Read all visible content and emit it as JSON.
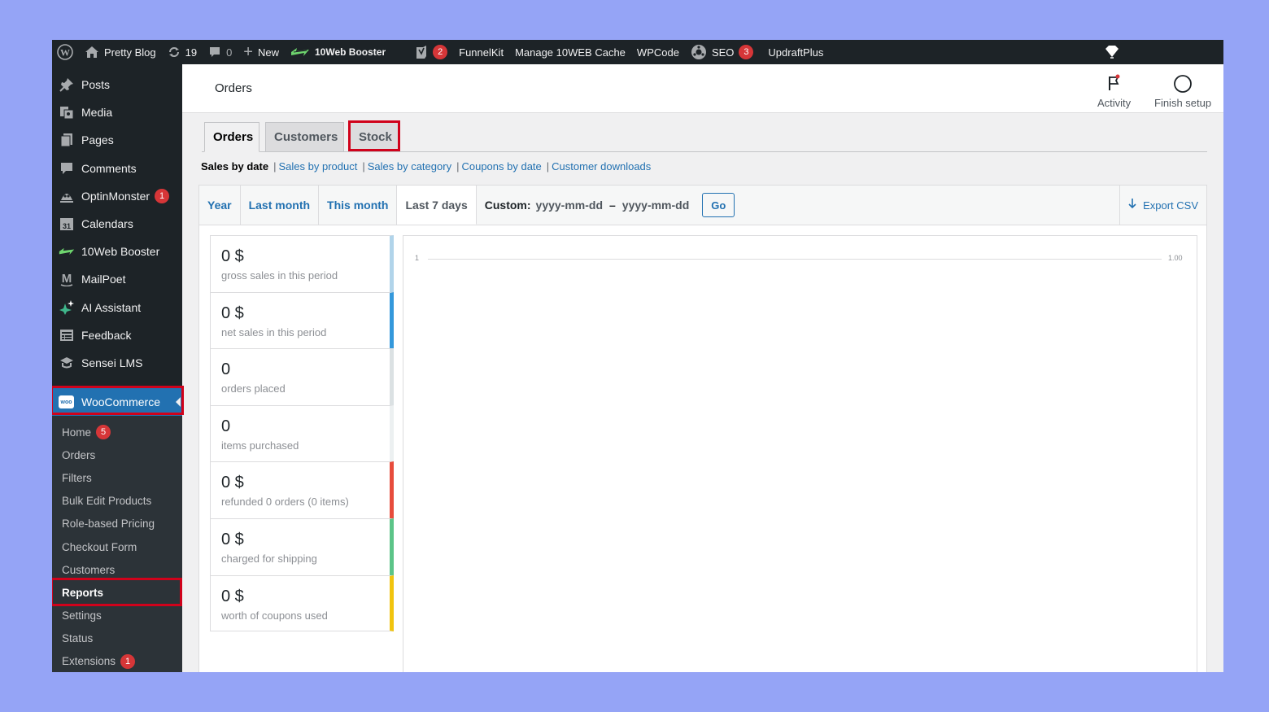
{
  "adminbar": {
    "site_name": "Pretty Blog",
    "updates_count": "19",
    "comments_count": "0",
    "new_label": "New",
    "booster_label": "10Web Booster",
    "yoast_badge": "2",
    "funnelkit": "FunnelKit",
    "manage_cache": "Manage 10WEB Cache",
    "wpcode": "WPCode",
    "seo": "SEO",
    "seo_badge": "3",
    "updraft": "UpdraftPlus"
  },
  "sidebar": {
    "items": [
      {
        "label": "Posts",
        "icon": "pin-icon"
      },
      {
        "label": "Media",
        "icon": "media-icon"
      },
      {
        "label": "Pages",
        "icon": "pages-icon"
      },
      {
        "label": "Comments",
        "icon": "comment-icon"
      },
      {
        "label": "OptinMonster",
        "icon": "optinmonster-icon",
        "badge": "1"
      },
      {
        "label": "Calendars",
        "icon": "calendar-icon"
      },
      {
        "label": "10Web Booster",
        "icon": "bolt-icon"
      },
      {
        "label": "MailPoet",
        "icon": "mailpoet-icon"
      },
      {
        "label": "AI Assistant",
        "icon": "sparkle-icon"
      },
      {
        "label": "Feedback",
        "icon": "feedback-icon"
      },
      {
        "label": "Sensei LMS",
        "icon": "sensei-icon"
      }
    ],
    "woocommerce": "WooCommerce",
    "woo_logo_text": "woo",
    "submenu": [
      {
        "label": "Home",
        "badge": "5"
      },
      {
        "label": "Orders"
      },
      {
        "label": "Filters"
      },
      {
        "label": "Bulk Edit Products"
      },
      {
        "label": "Role-based Pricing"
      },
      {
        "label": "Checkout Form"
      },
      {
        "label": "Customers"
      },
      {
        "label": "Reports"
      },
      {
        "label": "Settings"
      },
      {
        "label": "Status"
      },
      {
        "label": "Extensions",
        "badge": "1"
      }
    ]
  },
  "header": {
    "title": "Orders",
    "activity": "Activity",
    "finish_setup": "Finish setup"
  },
  "tabs": [
    "Orders",
    "Customers",
    "Stock"
  ],
  "sublinks": {
    "current": "Sales by date",
    "links": [
      "Sales by product",
      "Sales by category",
      "Coupons by date",
      "Customer downloads"
    ],
    "sep": "|"
  },
  "ranges": {
    "year": "Year",
    "last_month": "Last month",
    "this_month": "This month",
    "last_7": "Last 7 days",
    "custom_label": "Custom:",
    "from_placeholder": "yyyy-mm-dd",
    "dash": "–",
    "to_placeholder": "yyyy-mm-dd",
    "go": "Go",
    "export": "Export CSV"
  },
  "stats": [
    {
      "amount": "0 $",
      "label": "gross sales in this period",
      "color": "#b1d4ea"
    },
    {
      "amount": "0 $",
      "label": "net sales in this period",
      "color": "#3498db"
    },
    {
      "amount": "0",
      "label": "orders placed",
      "color": "#dbe1e3"
    },
    {
      "amount": "0",
      "label": "items purchased",
      "color": "#ecf0f1"
    },
    {
      "amount": "0 $",
      "label": "refunded 0 orders (0 items)",
      "color": "#e74c3c"
    },
    {
      "amount": "0 $",
      "label": "charged for shipping",
      "color": "#5cc488"
    },
    {
      "amount": "0 $",
      "label": "worth of coupons used",
      "color": "#f1c40f"
    }
  ],
  "chart": {
    "left_tick": "1",
    "right_tick": "1.00"
  }
}
